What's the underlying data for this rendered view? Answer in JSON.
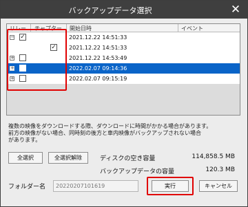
{
  "dialog": {
    "title": "バックアップデータ選択",
    "close_glyph": "✕"
  },
  "list": {
    "columns": [
      "リレー",
      "チャプター",
      "開始日時",
      "イベント"
    ],
    "rows": [
      {
        "date": "2021.12.22  14:51:33",
        "expander": "⊟",
        "checked": true,
        "selected": false,
        "level": 0
      },
      {
        "date": "2021.12.22  14:51:33",
        "expander": "",
        "checked": true,
        "selected": false,
        "level": 1
      },
      {
        "date": "2021.12.22  14:53:49",
        "expander": "⊞",
        "checked": false,
        "selected": false,
        "level": 0
      },
      {
        "date": "2022.02.07  09:14:36",
        "expander": "⊞",
        "checked": false,
        "selected": true,
        "level": 0
      },
      {
        "date": "2022.02.07  09:15:19",
        "expander": "⊞",
        "checked": false,
        "selected": false,
        "level": 0
      }
    ],
    "check_glyph": "✓"
  },
  "note": {
    "line1": "複数の映像をダウンロードする際、ダウンロードに時間がかかる場合があります。",
    "line2": "前方の映像がない場合、同時刻の後方と車内映像がバックアップされない場合",
    "line3": "があります。"
  },
  "buttons": {
    "select_all": "全選択",
    "deselect_all": "全選択解除",
    "execute": "実行",
    "cancel": "キャンセル"
  },
  "disk": {
    "free_label": "ディスクの空き容量",
    "free_value": "114,858.5 MB",
    "backup_label": "バックアップデータの容量",
    "backup_value": "120.3 MB"
  },
  "folder": {
    "label": "フォルダー名",
    "value": "20220207101619"
  },
  "colors": {
    "highlight": "#e00000",
    "selection": "#0a64c8",
    "titlebar": "#3f3f3f"
  }
}
